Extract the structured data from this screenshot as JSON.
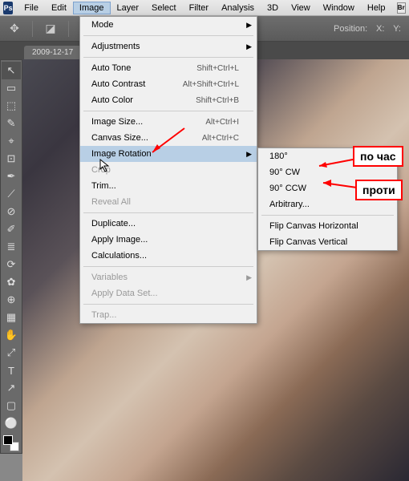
{
  "menubar": {
    "logo": "Ps",
    "items": [
      "File",
      "Edit",
      "Image",
      "Layer",
      "Select",
      "Filter",
      "Analysis",
      "3D",
      "View",
      "Window",
      "Help"
    ],
    "active_index": 2,
    "br": "Br"
  },
  "options": {
    "position_label": "Position:",
    "x_label": "X:",
    "y_label": "Y:"
  },
  "tabbar": {
    "tab": "2009-12-17"
  },
  "tools": [
    "↖",
    "▭",
    "⬚",
    "✎",
    "⌖",
    "⊡",
    "✒",
    "⟋",
    "⊘",
    "✐",
    "≣",
    "⟳",
    "✿",
    "⊕",
    "▦",
    "◐",
    "✋",
    "⤢",
    "T",
    "↗",
    "▢",
    "⚪"
  ],
  "dropdown": {
    "groups": [
      [
        {
          "label": "Mode",
          "arrow": true
        }
      ],
      [
        {
          "label": "Adjustments",
          "arrow": true
        }
      ],
      [
        {
          "label": "Auto Tone",
          "shortcut": "Shift+Ctrl+L"
        },
        {
          "label": "Auto Contrast",
          "shortcut": "Alt+Shift+Ctrl+L"
        },
        {
          "label": "Auto Color",
          "shortcut": "Shift+Ctrl+B"
        }
      ],
      [
        {
          "label": "Image Size...",
          "shortcut": "Alt+Ctrl+I"
        },
        {
          "label": "Canvas Size...",
          "shortcut": "Alt+Ctrl+C"
        },
        {
          "label": "Image Rotation",
          "arrow": true,
          "hovered": true
        },
        {
          "label": "Crop",
          "disabled": true
        },
        {
          "label": "Trim..."
        },
        {
          "label": "Reveal All",
          "disabled": true
        }
      ],
      [
        {
          "label": "Duplicate..."
        },
        {
          "label": "Apply Image..."
        },
        {
          "label": "Calculations..."
        }
      ],
      [
        {
          "label": "Variables",
          "arrow": true,
          "disabled": true
        },
        {
          "label": "Apply Data Set...",
          "disabled": true
        }
      ],
      [
        {
          "label": "Trap...",
          "disabled": true
        }
      ]
    ]
  },
  "submenu": {
    "groups": [
      [
        {
          "label": "180°"
        },
        {
          "label": "90° CW"
        },
        {
          "label": "90° CCW"
        },
        {
          "label": "Arbitrary..."
        }
      ],
      [
        {
          "label": "Flip Canvas Horizontal"
        },
        {
          "label": "Flip Canvas Vertical"
        }
      ]
    ]
  },
  "callouts": {
    "cw": "по час",
    "ccw": "проти"
  }
}
